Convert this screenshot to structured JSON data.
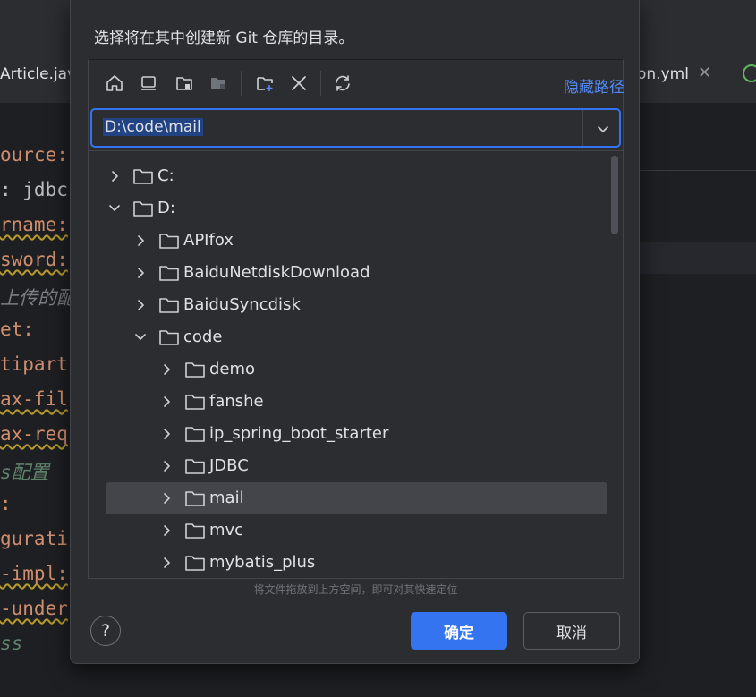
{
  "background": {
    "tabs": {
      "left": "Article.java",
      "right": "on.yml"
    },
    "code_lines": [
      {
        "text": "ource:",
        "style": "k",
        "underline": false
      },
      {
        "text": ": jdbc",
        "style": "w",
        "underline": false
      },
      {
        "text": "rname:",
        "style": "k",
        "underline": true
      },
      {
        "text": "sword:",
        "style": "k",
        "underline": true
      },
      {
        "text": "上传的配置",
        "style": "c",
        "underline": false
      },
      {
        "text": "et:",
        "style": "k",
        "underline": false
      },
      {
        "text": "tipart",
        "style": "k",
        "underline": false
      },
      {
        "text": "ax-fil",
        "style": "k",
        "underline": true
      },
      {
        "text": "ax-req",
        "style": "k",
        "underline": true
      },
      {
        "text": "s配置",
        "style": "cg",
        "underline": false
      },
      {
        "text": ":",
        "style": "k",
        "underline": false
      },
      {
        "text": "gurati",
        "style": "k",
        "underline": false
      },
      {
        "text": "-impl:",
        "style": "k",
        "underline": true
      },
      {
        "text": "-under",
        "style": "k",
        "underline": true
      },
      {
        "text": "ss",
        "style": "cg",
        "underline": false
      }
    ]
  },
  "dialog": {
    "title": "选择将在其中创建新 Git 仓库的目录。",
    "hide_path_label": "隐藏路径",
    "path_value": "D:\\code\\mail",
    "tree": [
      {
        "label": "C:",
        "level": 0,
        "expanded": false,
        "selected": false
      },
      {
        "label": "D:",
        "level": 0,
        "expanded": true,
        "selected": false
      },
      {
        "label": "APIfox",
        "level": 1,
        "expanded": false,
        "selected": false
      },
      {
        "label": "BaiduNetdiskDownload",
        "level": 1,
        "expanded": false,
        "selected": false
      },
      {
        "label": "BaiduSyncdisk",
        "level": 1,
        "expanded": false,
        "selected": false
      },
      {
        "label": "code",
        "level": 1,
        "expanded": true,
        "selected": false
      },
      {
        "label": "demo",
        "level": 2,
        "expanded": false,
        "selected": false
      },
      {
        "label": "fanshe",
        "level": 2,
        "expanded": false,
        "selected": false
      },
      {
        "label": "ip_spring_boot_starter",
        "level": 2,
        "expanded": false,
        "selected": false
      },
      {
        "label": "JDBC",
        "level": 2,
        "expanded": false,
        "selected": false
      },
      {
        "label": "mail",
        "level": 2,
        "expanded": false,
        "selected": true
      },
      {
        "label": "mvc",
        "level": 2,
        "expanded": false,
        "selected": false
      },
      {
        "label": "mybatis_plus",
        "level": 2,
        "expanded": false,
        "selected": false
      }
    ],
    "hint": "将文件拖放到上方空间，即可对其快速定位",
    "help_label": "?",
    "ok_label": "确定",
    "cancel_label": "取消",
    "toolbar_icons": [
      "home-icon",
      "desktop-icon",
      "project-folder-icon",
      "module-folder-icon",
      "new-folder-icon",
      "delete-icon",
      "refresh-icon"
    ]
  },
  "colors": {
    "accent": "#3574f0",
    "link": "#548af7",
    "dialog_bg": "#2b2d30",
    "selection": "#43454a"
  }
}
